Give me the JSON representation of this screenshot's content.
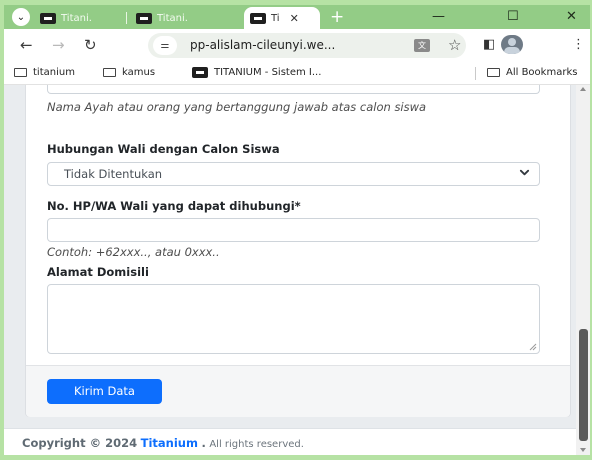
{
  "browser": {
    "tabs": [
      {
        "title": "Titani.",
        "active": false
      },
      {
        "title": "Titani.",
        "active": false
      },
      {
        "title": "Ti",
        "active": true
      }
    ],
    "new_tab_symbol": "+",
    "window_controls": {
      "minimize": "—",
      "maximize": "☐",
      "close": "✕"
    },
    "url": "pp-alislam-cileunyi.we...",
    "bookmarks": [
      {
        "label": "titanium",
        "icon": "folder-icon"
      },
      {
        "label": "kamus",
        "icon": "folder-icon"
      },
      {
        "label": "TITANIUM - Sistem I...",
        "icon": "site-favicon"
      },
      {
        "label": "All Bookmarks",
        "icon": "folder-icon"
      }
    ]
  },
  "form": {
    "wali_name_help": "Nama Ayah atau orang yang bertanggung jawab atas calon siswa",
    "relation": {
      "label": "Hubungan Wali dengan Calon Siswa",
      "selected": "Tidak Ditentukan"
    },
    "phone": {
      "label": "No. HP/WA Wali yang dapat dihubungi*",
      "value": "",
      "help": "Contoh: +62xxx.., atau 0xxx.."
    },
    "address": {
      "label": "Alamat Domisili",
      "value": ""
    },
    "submit_label": "Kirim Data"
  },
  "footer": {
    "copyright": "Copyright © 2024",
    "brand": "Titanium",
    "dot": ".",
    "rights": "All rights reserved."
  },
  "colors": {
    "chrome_tabstrip": "#93cc86",
    "accent": "#0d6efd",
    "page_background": "#e9ecef"
  }
}
